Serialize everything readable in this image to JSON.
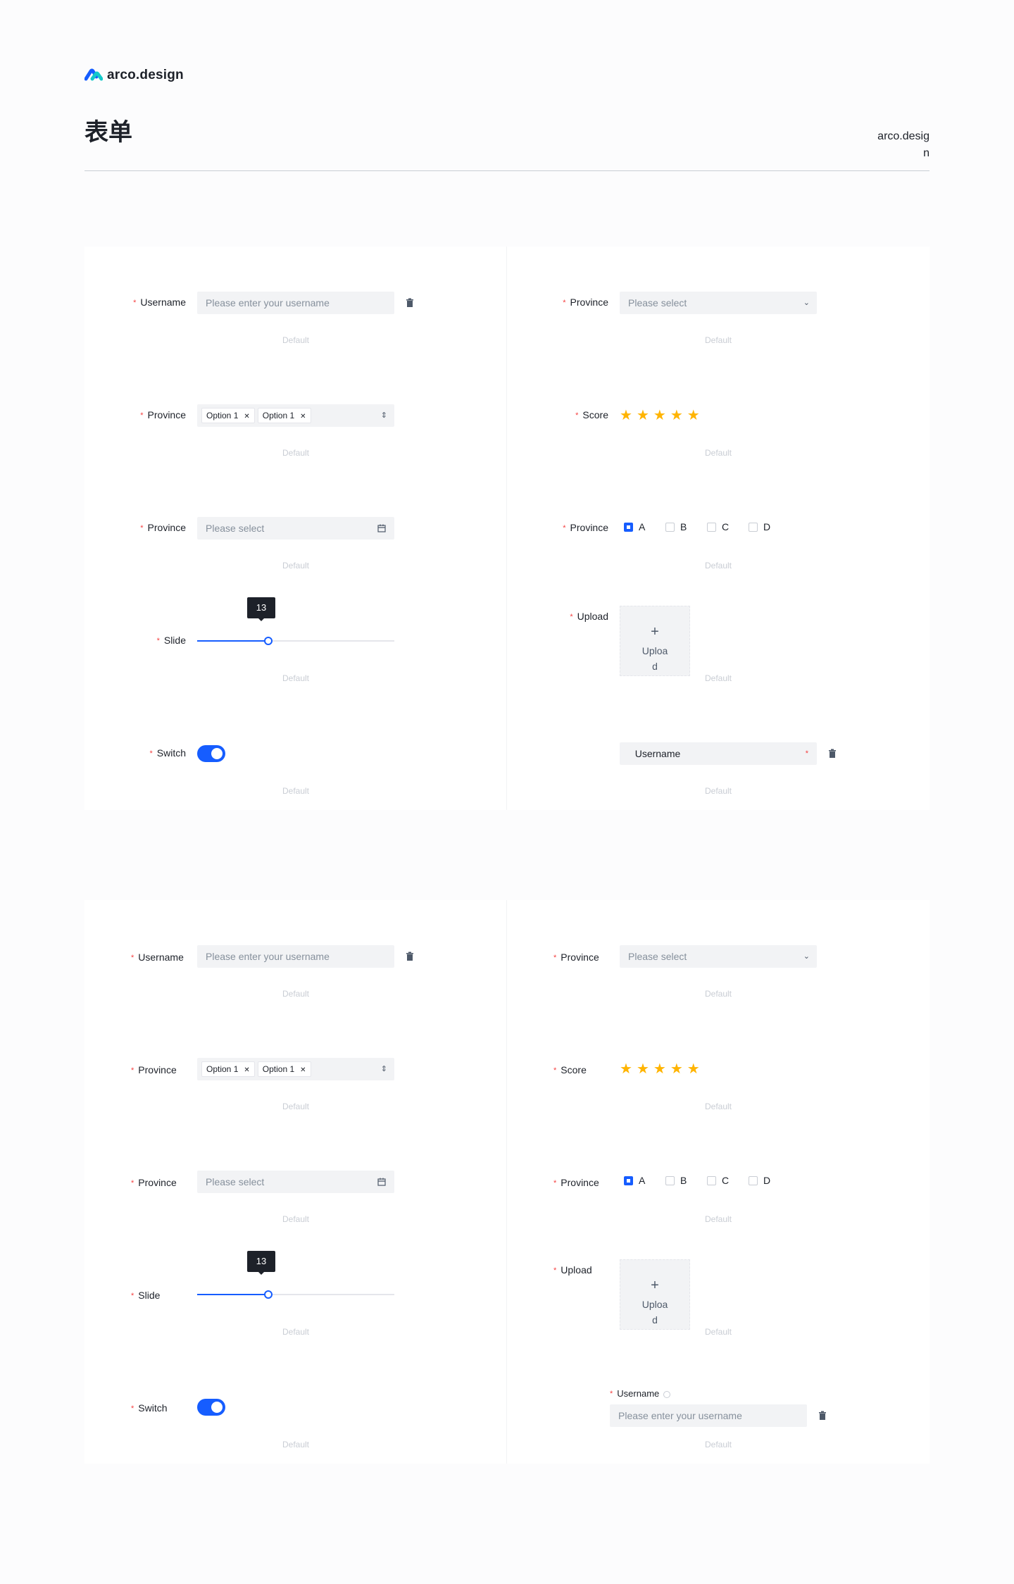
{
  "header": {
    "logo_text": "arco.design",
    "page_title": "表单",
    "brand_right": "arco.design"
  },
  "colors": {
    "primary": "#165dff",
    "required": "#f53f3f",
    "star": "#ffb400",
    "input_bg": "#f2f3f5"
  },
  "form": {
    "username_label": "Username",
    "username_placeholder": "Please enter your username",
    "province_label": "Province",
    "select_placeholder": "Please select",
    "score_label": "Score",
    "score_value": 5,
    "tags": [
      "Option 1",
      "Option 1"
    ],
    "date_placeholder": "Please select",
    "checkbox_options": [
      "A",
      "B",
      "C",
      "D"
    ],
    "checked_option": "A",
    "slide_label": "Slide",
    "slider_value": "13",
    "slider_fraction": 0.36,
    "upload_label": "Upload",
    "upload_button": "Upload",
    "switch_label": "Switch",
    "switch_on": true,
    "hint": "Default"
  }
}
